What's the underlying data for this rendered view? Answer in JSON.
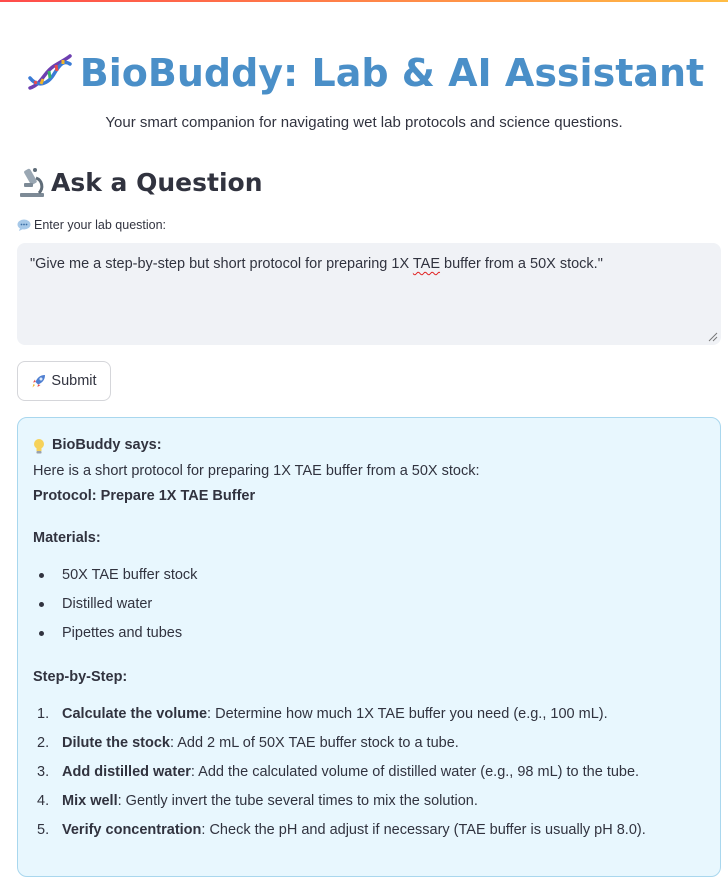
{
  "app": {
    "title": "BioBuddy: Lab & AI Assistant",
    "title_icon": "dna-icon",
    "tagline": "Your smart companion for navigating wet lab protocols and science questions."
  },
  "ask": {
    "heading": "Ask a Question",
    "heading_icon": "microscope-icon",
    "label": "Enter your lab question:",
    "label_icon": "speech-bubble-icon",
    "question_pre": "\"Give me a step-by-step but short protocol for preparing 1X ",
    "question_flag": "TAE",
    "question_post": " buffer from a 50X stock.\"",
    "submit_label": "Submit",
    "submit_icon": "rocket-icon"
  },
  "answer": {
    "says_icon": "lightbulb-icon",
    "says_label": "BioBuddy says:",
    "intro": "Here is a short protocol for preparing 1X TAE buffer from a 50X stock:",
    "protocol_title": "Protocol: Prepare 1X TAE Buffer",
    "materials_title": "Materials:",
    "materials": [
      "50X TAE buffer stock",
      "Distilled water",
      "Pipettes and tubes"
    ],
    "steps_title": "Step-by-Step:",
    "steps": [
      {
        "num": "1.",
        "bold": "Calculate the volume",
        "text": ": Determine how much 1X TAE buffer you need (e.g., 100 mL)."
      },
      {
        "num": "2.",
        "bold": "Dilute the stock",
        "text": ": Add 2 mL of 50X TAE buffer stock to a tube."
      },
      {
        "num": "3.",
        "bold": "Add distilled water",
        "text": ": Add the calculated volume of distilled water (e.g., 98 mL) to the tube."
      },
      {
        "num": "4.",
        "bold": "Mix well",
        "text": ": Gently invert the tube several times to mix the solution."
      },
      {
        "num": "5.",
        "bold": "Verify concentration",
        "text": ": Check the pH and adjust if necessary (TAE buffer is usually pH 8.0)."
      }
    ]
  },
  "colors": {
    "title": "#4a8fc8",
    "answer_bg": "#e8f7fe",
    "answer_border": "#a9d7ee",
    "input_bg": "#f0f2f6"
  }
}
